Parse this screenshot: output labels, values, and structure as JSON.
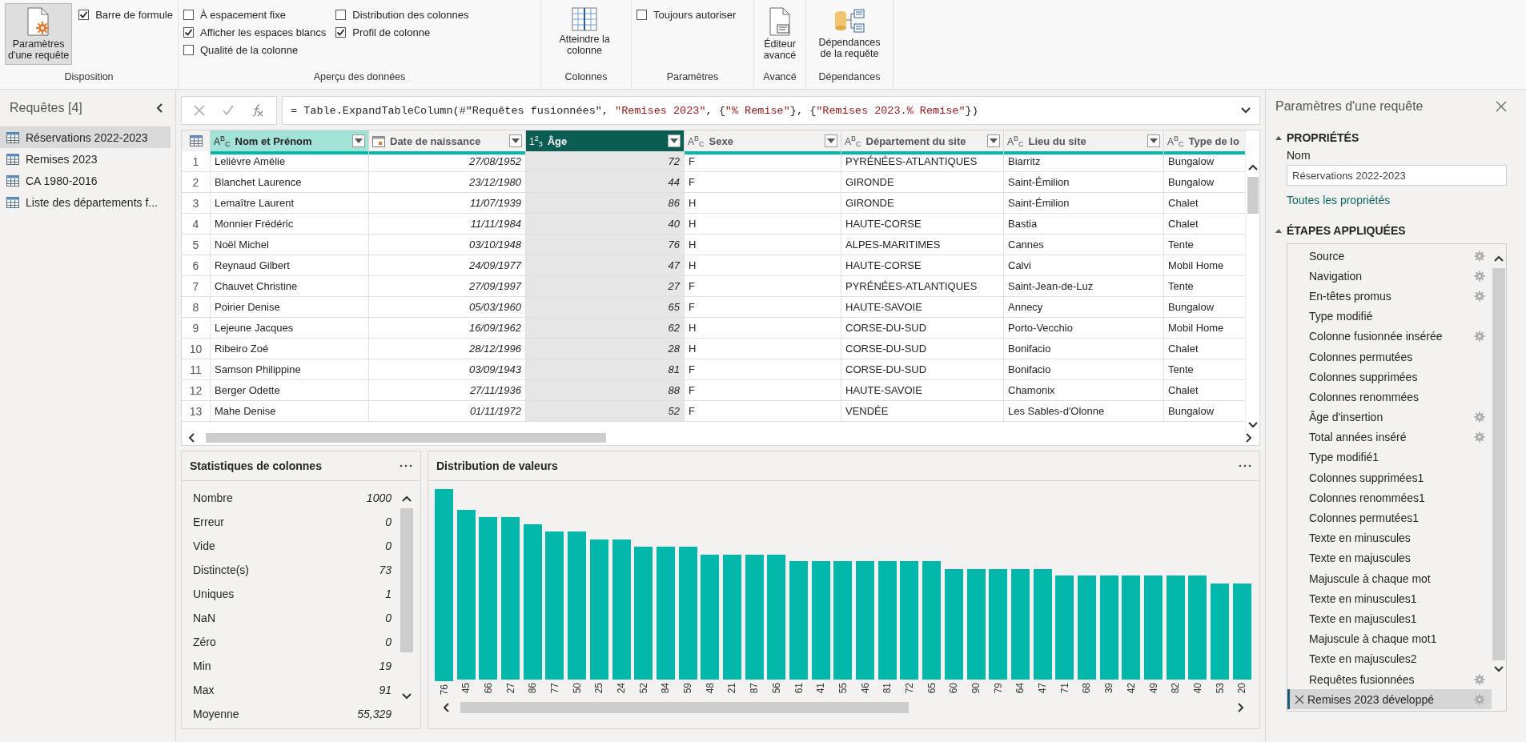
{
  "ribbon": {
    "groups": [
      {
        "label": "Disposition",
        "items": [
          {
            "kind": "big_button",
            "label": "Paramètres d'une requête",
            "selected": true
          },
          {
            "kind": "checkbox",
            "label": "Barre de formule",
            "checked": true
          }
        ]
      },
      {
        "label": "Aperçu des données",
        "items": [
          {
            "kind": "checkbox",
            "label": "À espacement fixe",
            "checked": false
          },
          {
            "kind": "checkbox",
            "label": "Afficher les espaces blancs",
            "checked": true
          },
          {
            "kind": "checkbox",
            "label": "Qualité de la colonne",
            "checked": false
          },
          {
            "kind": "checkbox",
            "label": "Distribution des colonnes",
            "checked": false
          },
          {
            "kind": "checkbox",
            "label": "Profil de colonne",
            "checked": true
          }
        ]
      },
      {
        "label": "Colonnes",
        "items": [
          {
            "kind": "big_button",
            "label": "Atteindre la colonne",
            "selected": false
          }
        ]
      },
      {
        "label": "Paramètres",
        "items": [
          {
            "kind": "checkbox",
            "label": "Toujours autoriser",
            "checked": false
          }
        ]
      },
      {
        "label": "Avancé",
        "items": [
          {
            "kind": "big_button",
            "label": "Éditeur avancé",
            "selected": false
          }
        ]
      },
      {
        "label": "Dépendances",
        "items": [
          {
            "kind": "big_button",
            "label": "Dépendances de la requête",
            "selected": false
          }
        ]
      }
    ]
  },
  "queries": {
    "title": "Requêtes [4]",
    "items": [
      {
        "label": "Réservations 2022-2023",
        "selected": true
      },
      {
        "label": "Remises 2023",
        "selected": false
      },
      {
        "label": "CA 1980-2016",
        "selected": false
      },
      {
        "label": "Liste des départements f...",
        "selected": false
      }
    ]
  },
  "formula": {
    "parts": [
      {
        "kind": "code",
        "text": "= Table.ExpandTableColumn(#\"Requêtes fusionnées\", "
      },
      {
        "kind": "string",
        "text": "\"Remises 2023\""
      },
      {
        "kind": "code",
        "text": ", {"
      },
      {
        "kind": "string",
        "text": "\"% Remise\""
      },
      {
        "kind": "code",
        "text": "}, {"
      },
      {
        "kind": "string",
        "text": "\"Remises 2023.% Remise\""
      },
      {
        "kind": "code",
        "text": "})"
      }
    ]
  },
  "table": {
    "columns": [
      {
        "name": "Nom et Prénom",
        "kind": "text",
        "type_mark": "A$^{B}$$_{C}$",
        "selected": false,
        "highlighted": true
      },
      {
        "name": "Date de naissance",
        "kind": "date",
        "selected": false,
        "highlighted": false
      },
      {
        "name": "Âge",
        "kind": "number",
        "type_mark": "1$^{2}$$_{3}$",
        "selected": true,
        "highlighted": false
      },
      {
        "name": "Sexe",
        "kind": "text",
        "type_mark": "A$^{B}$$_{C}$",
        "selected": false,
        "highlighted": false
      },
      {
        "name": "Département du site",
        "kind": "text",
        "type_mark": "A$^{B}$$_{C}$",
        "selected": false,
        "highlighted": false
      },
      {
        "name": "Lieu du site",
        "kind": "text",
        "type_mark": "A$^{B}$$_{C}$",
        "selected": false,
        "highlighted": false
      },
      {
        "name": "Type de lo",
        "kind": "text",
        "type_mark": "A$^{B}$$_{C}$",
        "selected": false,
        "highlighted": false
      }
    ],
    "rows": [
      {
        "number": "1",
        "cells": [
          "Lelièvre Amélie",
          "27/08/1952",
          "72",
          "F",
          "PYRÉNÉES-ATLANTIQUES",
          "Biarritz",
          "Bungalow"
        ]
      },
      {
        "number": "2",
        "cells": [
          "Blanchet Laurence",
          "23/12/1980",
          "44",
          "F",
          "GIRONDE",
          "Saint-Émilion",
          "Bungalow"
        ]
      },
      {
        "number": "3",
        "cells": [
          "Lemaître Laurent",
          "11/07/1939",
          "86",
          "H",
          "GIRONDE",
          "Saint-Émilion",
          "Chalet"
        ]
      },
      {
        "number": "4",
        "cells": [
          "Monnier Frédéric",
          "11/11/1984",
          "40",
          "H",
          "HAUTE-CORSE",
          "Bastia",
          "Chalet"
        ]
      },
      {
        "number": "5",
        "cells": [
          "Noël Michel",
          "03/10/1948",
          "76",
          "H",
          "ALPES-MARITIMES",
          "Cannes",
          "Tente"
        ]
      },
      {
        "number": "6",
        "cells": [
          "Reynaud Gilbert",
          "24/09/1977",
          "47",
          "H",
          "HAUTE-CORSE",
          "Calvi",
          "Mobil Home"
        ]
      },
      {
        "number": "7",
        "cells": [
          "Chauvet Christine",
          "27/09/1997",
          "27",
          "F",
          "PYRÉNÉES-ATLANTIQUES",
          "Saint-Jean-de-Luz",
          "Tente"
        ]
      },
      {
        "number": "8",
        "cells": [
          "Poirier Denise",
          "05/03/1960",
          "65",
          "F",
          "HAUTE-SAVOIE",
          "Annecy",
          "Bungalow"
        ]
      },
      {
        "number": "9",
        "cells": [
          "Lejeune Jacques",
          "16/09/1962",
          "62",
          "H",
          "CORSE-DU-SUD",
          "Porto-Vecchio",
          "Mobil Home"
        ]
      },
      {
        "number": "10",
        "cells": [
          "Ribeiro Zoé",
          "28/12/1996",
          "28",
          "H",
          "CORSE-DU-SUD",
          "Bonifacio",
          "Chalet"
        ]
      },
      {
        "number": "11",
        "cells": [
          "Samson Philippine",
          "03/09/1943",
          "81",
          "F",
          "CORSE-DU-SUD",
          "Bonifacio",
          "Tente"
        ]
      },
      {
        "number": "12",
        "cells": [
          "Berger Odette",
          "27/11/1936",
          "88",
          "F",
          "HAUTE-SAVOIE",
          "Chamonix",
          "Chalet"
        ]
      },
      {
        "number": "13",
        "cells": [
          "Mahe Denise",
          "01/11/1972",
          "52",
          "F",
          "VENDÉE",
          "Les Sables-d'Olonne",
          "Bungalow"
        ]
      }
    ]
  },
  "statistics": {
    "title": "Statistiques de colonnes",
    "rows": [
      {
        "label": "Nombre",
        "value": "1000"
      },
      {
        "label": "Erreur",
        "value": "0"
      },
      {
        "label": "Vide",
        "value": "0"
      },
      {
        "label": "Distincte(s)",
        "value": "73"
      },
      {
        "label": "Uniques",
        "value": "1"
      },
      {
        "label": "NaN",
        "value": "0"
      },
      {
        "label": "Zéro",
        "value": "0"
      },
      {
        "label": "Min",
        "value": "19"
      },
      {
        "label": "Max",
        "value": "91"
      },
      {
        "label": "Moyenne",
        "value": "55,329"
      }
    ]
  },
  "distribution": {
    "title": "Distribution de valeurs",
    "bar_labels": [
      "76",
      "45",
      "66",
      "27",
      "86",
      "77",
      "50",
      "25",
      "24",
      "52",
      "84",
      "59",
      "48",
      "21",
      "87",
      "56",
      "61",
      "41",
      "55",
      "46",
      "81",
      "72",
      "65",
      "60",
      "90",
      "79",
      "64",
      "47",
      "71",
      "68",
      "39",
      "42",
      "49",
      "82",
      "40",
      "53",
      "20"
    ]
  },
  "settings": {
    "title": "Paramètres d'une requête",
    "properties_heading": "PROPRIÉTÉS",
    "name_label": "Nom",
    "name_value": "Réservations 2022-2023",
    "all_properties_link": "Toutes les propriétés",
    "steps_heading": "ÉTAPES APPLIQUÉES",
    "steps": [
      {
        "label": "Source",
        "has_settings": true,
        "selected": false
      },
      {
        "label": "Navigation",
        "has_settings": true,
        "selected": false
      },
      {
        "label": "En-têtes promus",
        "has_settings": true,
        "selected": false
      },
      {
        "label": "Type modifié",
        "has_settings": false,
        "selected": false
      },
      {
        "label": "Colonne fusionnée insérée",
        "has_settings": true,
        "selected": false
      },
      {
        "label": "Colonnes permutées",
        "has_settings": false,
        "selected": false
      },
      {
        "label": "Colonnes supprimées",
        "has_settings": false,
        "selected": false
      },
      {
        "label": "Colonnes renommées",
        "has_settings": false,
        "selected": false
      },
      {
        "label": "Âge d'insertion",
        "has_settings": true,
        "selected": false
      },
      {
        "label": "Total années inséré",
        "has_settings": true,
        "selected": false
      },
      {
        "label": "Type modifié1",
        "has_settings": false,
        "selected": false
      },
      {
        "label": "Colonnes supprimées1",
        "has_settings": false,
        "selected": false
      },
      {
        "label": "Colonnes renommées1",
        "has_settings": false,
        "selected": false
      },
      {
        "label": "Colonnes permutées1",
        "has_settings": false,
        "selected": false
      },
      {
        "label": "Texte en minuscules",
        "has_settings": false,
        "selected": false
      },
      {
        "label": "Texte en majuscules",
        "has_settings": false,
        "selected": false
      },
      {
        "label": "Majuscule à chaque mot",
        "has_settings": false,
        "selected": false
      },
      {
        "label": "Texte en minuscules1",
        "has_settings": false,
        "selected": false
      },
      {
        "label": "Texte en majuscules1",
        "has_settings": false,
        "selected": false
      },
      {
        "label": "Majuscule à chaque mot1",
        "has_settings": false,
        "selected": false
      },
      {
        "label": "Texte en majuscules2",
        "has_settings": false,
        "selected": false
      },
      {
        "label": "Requêtes fusionnées",
        "has_settings": true,
        "selected": false
      },
      {
        "label": "Remises 2023 développé",
        "has_settings": true,
        "selected": true
      }
    ]
  }
}
